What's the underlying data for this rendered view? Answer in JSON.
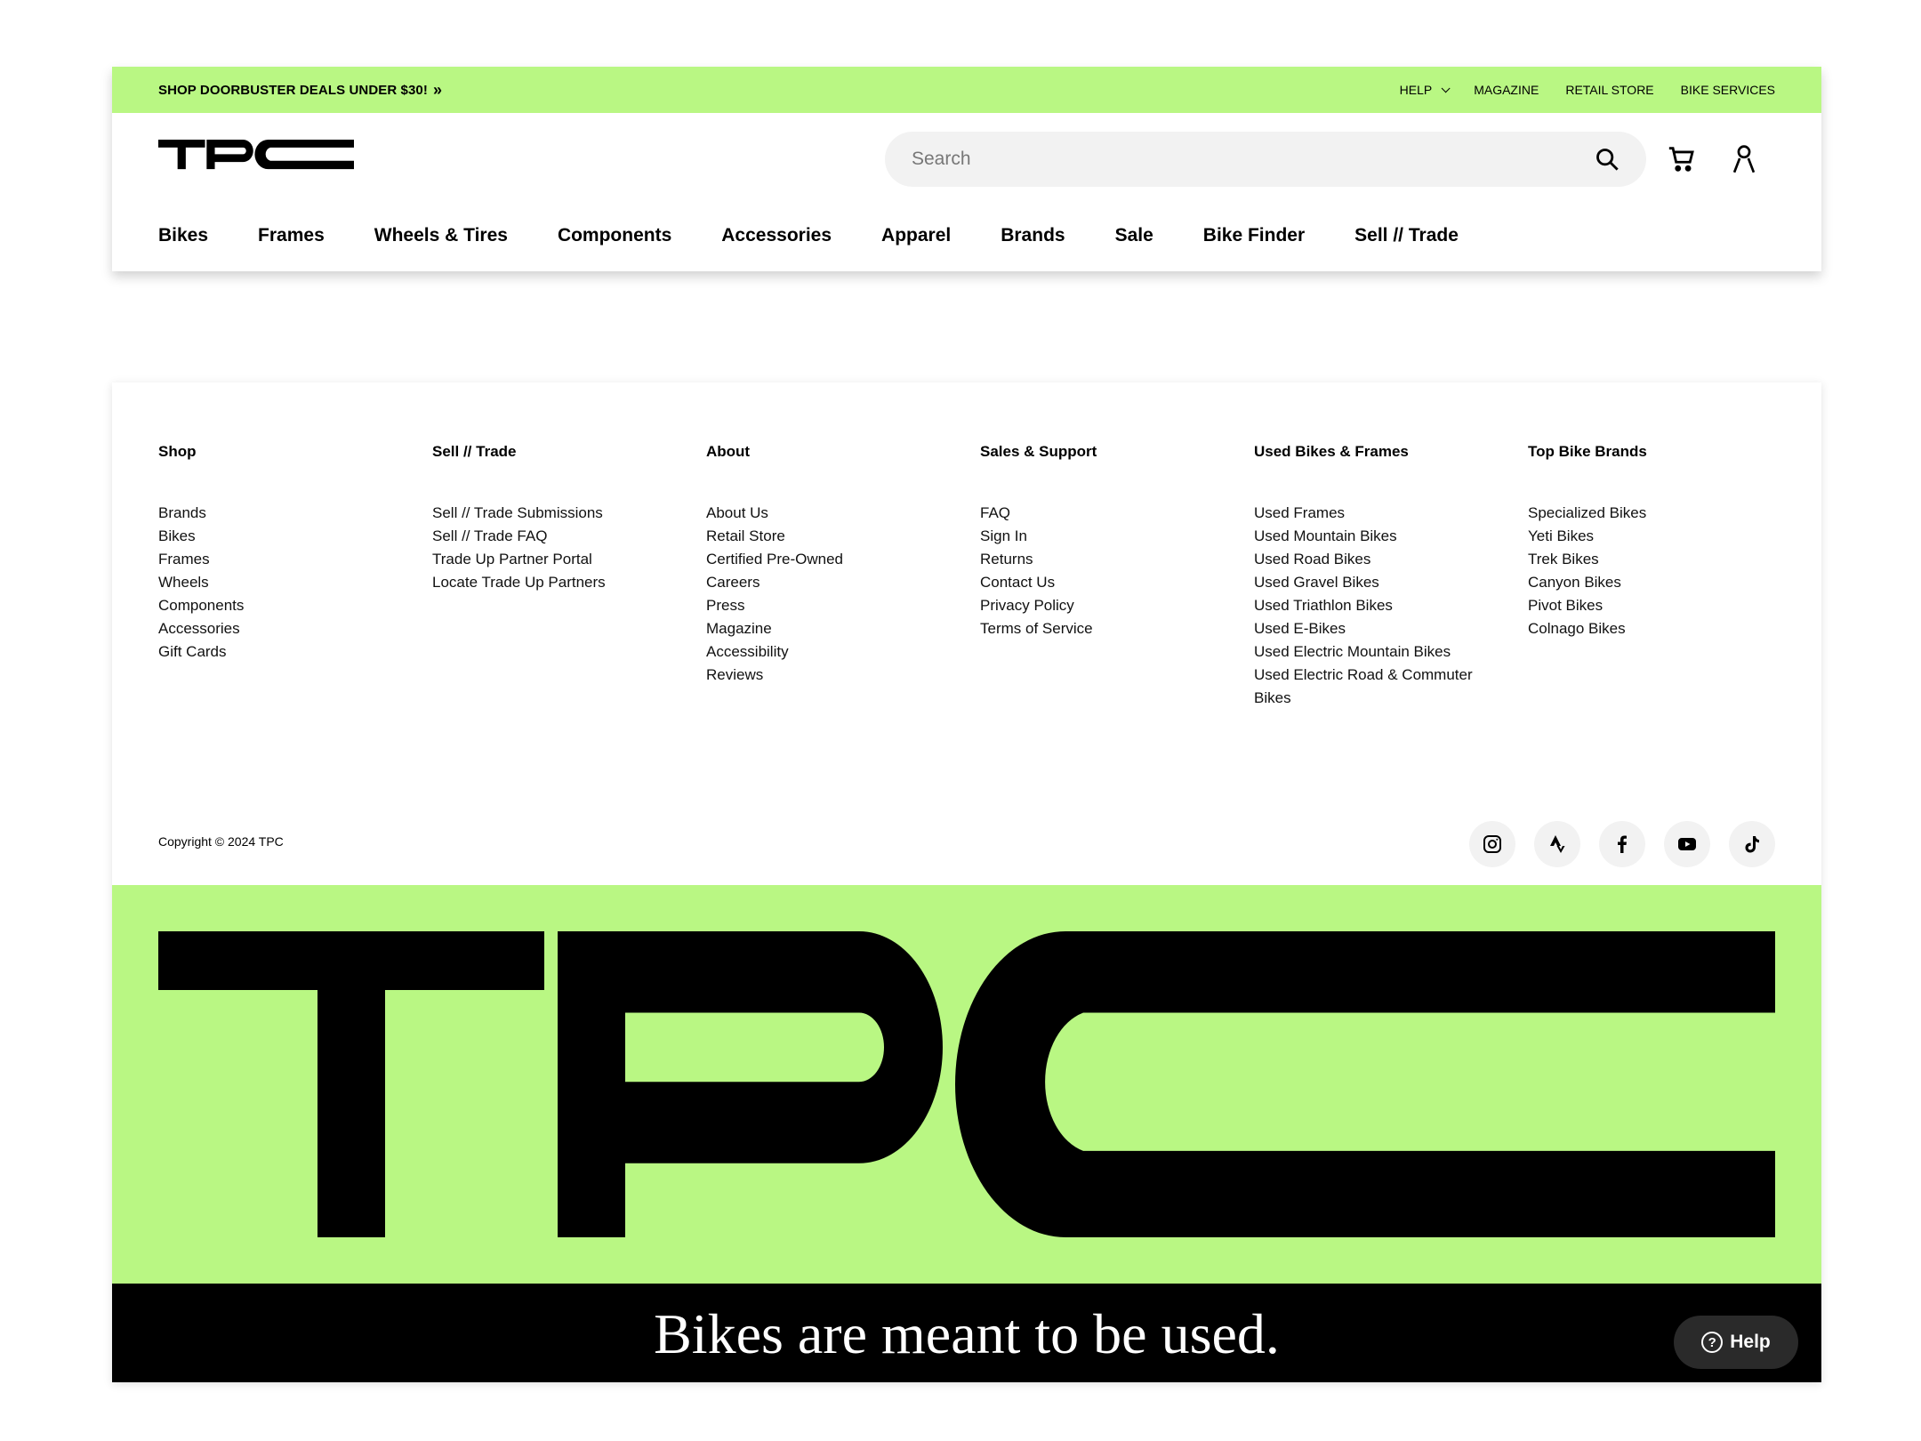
{
  "promo": {
    "text": "SHOP DOORBUSTER DEALS UNDER $30!",
    "arrow": "»"
  },
  "utility_links": [
    {
      "label": "HELP"
    },
    {
      "label": "MAGAZINE"
    },
    {
      "label": "RETAIL STORE"
    },
    {
      "label": "BIKE SERVICES"
    }
  ],
  "brand": {
    "logo_text": "TPC",
    "accent_color": "#b9f783"
  },
  "search": {
    "placeholder": "Search"
  },
  "main_nav": [
    "Bikes",
    "Frames",
    "Wheels & Tires",
    "Components",
    "Accessories",
    "Apparel",
    "Brands",
    "Sale",
    "Bike Finder",
    "Sell // Trade"
  ],
  "footer": {
    "columns": [
      {
        "heading": "Shop",
        "links": [
          "Brands",
          "Bikes",
          "Frames",
          "Wheels",
          "Components",
          "Accessories",
          "Gift Cards"
        ]
      },
      {
        "heading": "Sell // Trade",
        "links": [
          "Sell // Trade Submissions",
          "Sell // Trade FAQ",
          "Trade Up Partner Portal",
          "Locate Trade Up Partners"
        ]
      },
      {
        "heading": "About",
        "links": [
          "About Us",
          "Retail Store",
          "Certified Pre-Owned",
          "Careers",
          "Press",
          "Magazine",
          "Accessibility",
          "Reviews"
        ]
      },
      {
        "heading": "Sales & Support",
        "links": [
          "FAQ",
          "Sign In",
          "Returns",
          "Contact Us",
          "Privacy Policy",
          "Terms of Service"
        ]
      },
      {
        "heading": "Used Bikes & Frames",
        "links": [
          "Used Frames",
          "Used Mountain Bikes",
          "Used Road Bikes",
          "Used Gravel Bikes",
          "Used Triathlon Bikes",
          "Used E-Bikes",
          "Used Electric Mountain Bikes",
          "Used Electric Road & Commuter",
          "Bikes"
        ]
      },
      {
        "heading": "Top Bike Brands",
        "links": [
          "Specialized Bikes",
          "Yeti Bikes",
          "Trek Bikes",
          "Canyon Bikes",
          "Pivot Bikes",
          "Colnago Bikes"
        ]
      }
    ],
    "copyright": "Copyright © 2024 TPC",
    "socials": [
      "instagram-icon",
      "strava-icon",
      "facebook-icon",
      "youtube-icon",
      "tiktok-icon"
    ],
    "tagline": "Bikes are meant to be used.",
    "help_label": "Help"
  }
}
